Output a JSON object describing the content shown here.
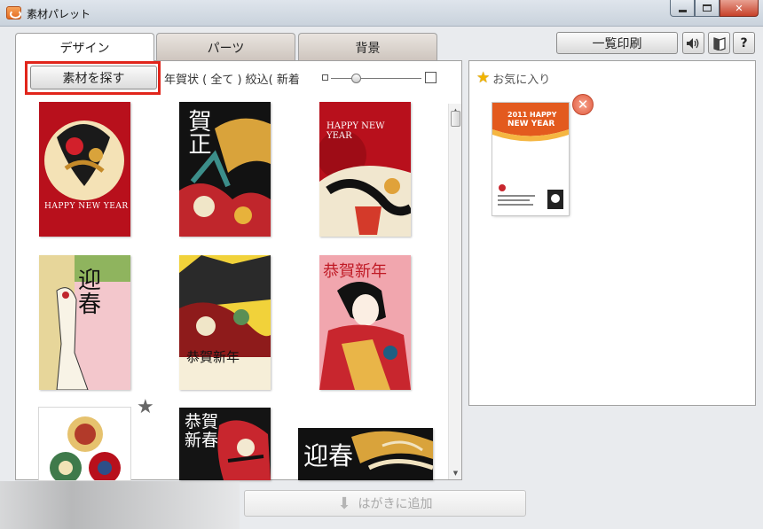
{
  "window": {
    "title": "素材パレット",
    "close_glyph": "✕",
    "help_label": "?"
  },
  "tabs": [
    {
      "label": "デザイン"
    },
    {
      "label": "パーツ"
    },
    {
      "label": "背景"
    }
  ],
  "toolbar": {
    "search_label": "素材を探す",
    "filter_text": "年賀状 ( 全て ) 絞込( 新着",
    "print_label": "一覧印刷"
  },
  "favorites": {
    "label": "お気に入り",
    "card": {
      "line1": "2011 HAPPY",
      "line2": "NEW YEAR"
    }
  },
  "designs": [
    {
      "text": "HAPPY NEW YEAR"
    },
    {
      "text": "賀正"
    },
    {
      "text": "HAPPY NEW YEAR"
    },
    {
      "text": "迎春"
    },
    {
      "text": "恭賀新年"
    },
    {
      "text": "恭賀新年"
    },
    {
      "text": ""
    },
    {
      "text": "恭賀新春"
    },
    {
      "text": "迎春"
    }
  ],
  "add_button": {
    "label": "はがきに追加"
  },
  "colors": {
    "highlight": "#e1251b",
    "accent": "#e35a1e"
  }
}
